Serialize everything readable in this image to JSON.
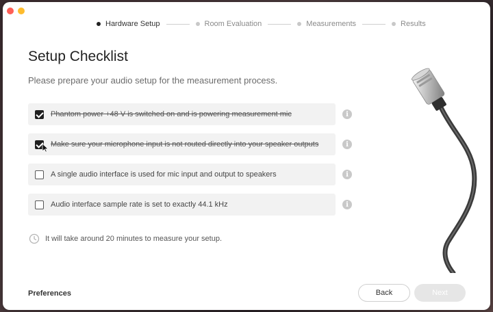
{
  "steps": [
    {
      "label": "Hardware Setup",
      "active": true
    },
    {
      "label": "Room Evaluation",
      "active": false
    },
    {
      "label": "Measurements",
      "active": false
    },
    {
      "label": "Results",
      "active": false
    }
  ],
  "title": "Setup Checklist",
  "subtitle": "Please prepare your audio setup for the measurement process.",
  "checklist": [
    {
      "label": "Phantom power +48 V is switched on and is powering measurement mic",
      "checked": true
    },
    {
      "label": "Make sure your microphone input is not routed directly into your speaker outputs",
      "checked": true
    },
    {
      "label": "A single audio interface is used for mic input and output to speakers",
      "checked": false
    },
    {
      "label": "Audio interface sample rate is set to exactly 44.1 kHz",
      "checked": false
    }
  ],
  "info_glyph": "i",
  "time_note": "It will take around 20 minutes to measure your setup.",
  "footer": {
    "preferences": "Preferences",
    "back": "Back",
    "next": "Next"
  },
  "colors": {
    "close": "#ff5f57",
    "minimize": "#febc2e",
    "checked_fill": "#1e1e1e",
    "next_disabled": "#e6e6e6"
  },
  "icons": [
    "clock-icon",
    "info-icon",
    "checkbox-icon",
    "xlr-cable-illustration"
  ]
}
